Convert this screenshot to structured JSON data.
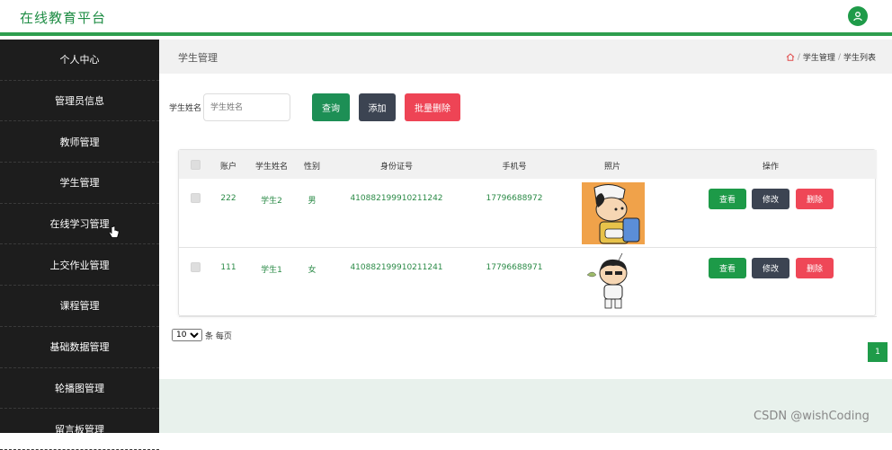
{
  "header": {
    "brand": "在线教育平台"
  },
  "sidebar": {
    "items": [
      {
        "label": "个人中心"
      },
      {
        "label": "管理员信息"
      },
      {
        "label": "教师管理"
      },
      {
        "label": "学生管理"
      },
      {
        "label": "在线学习管理"
      },
      {
        "label": "上交作业管理"
      },
      {
        "label": "课程管理"
      },
      {
        "label": "基础数据管理"
      },
      {
        "label": "轮播图管理"
      },
      {
        "label": "留言板管理"
      }
    ]
  },
  "crumb": {
    "title": "学生管理",
    "sep": "/",
    "level1": "学生管理",
    "level2": "学生列表"
  },
  "search": {
    "label": "学生姓名",
    "placeholder": "学生姓名",
    "query_label": "查询",
    "add_label": "添加",
    "batch_delete_label": "批量删除"
  },
  "table": {
    "headers": [
      "账户",
      "学生姓名",
      "性别",
      "身份证号",
      "手机号",
      "照片",
      "操作"
    ],
    "rows": [
      {
        "account": "222",
        "name": "学生2",
        "gender": "男",
        "id_card": "410882199910211242",
        "phone": "17796688972"
      },
      {
        "account": "111",
        "name": "学生1",
        "gender": "女",
        "id_card": "410882199910211241",
        "phone": "17796688971"
      }
    ],
    "actions": {
      "view": "查看",
      "edit": "修改",
      "delete": "删除"
    }
  },
  "pager": {
    "page_size": "10",
    "per_page_label": "条 每页",
    "current_page": "1"
  },
  "watermark": "CSDN @wishCoding",
  "colors": {
    "accent": "#1f9b49",
    "sidebar_bg": "#1d1d1d",
    "danger": "#ee4455",
    "dark_button": "#3c4452"
  }
}
